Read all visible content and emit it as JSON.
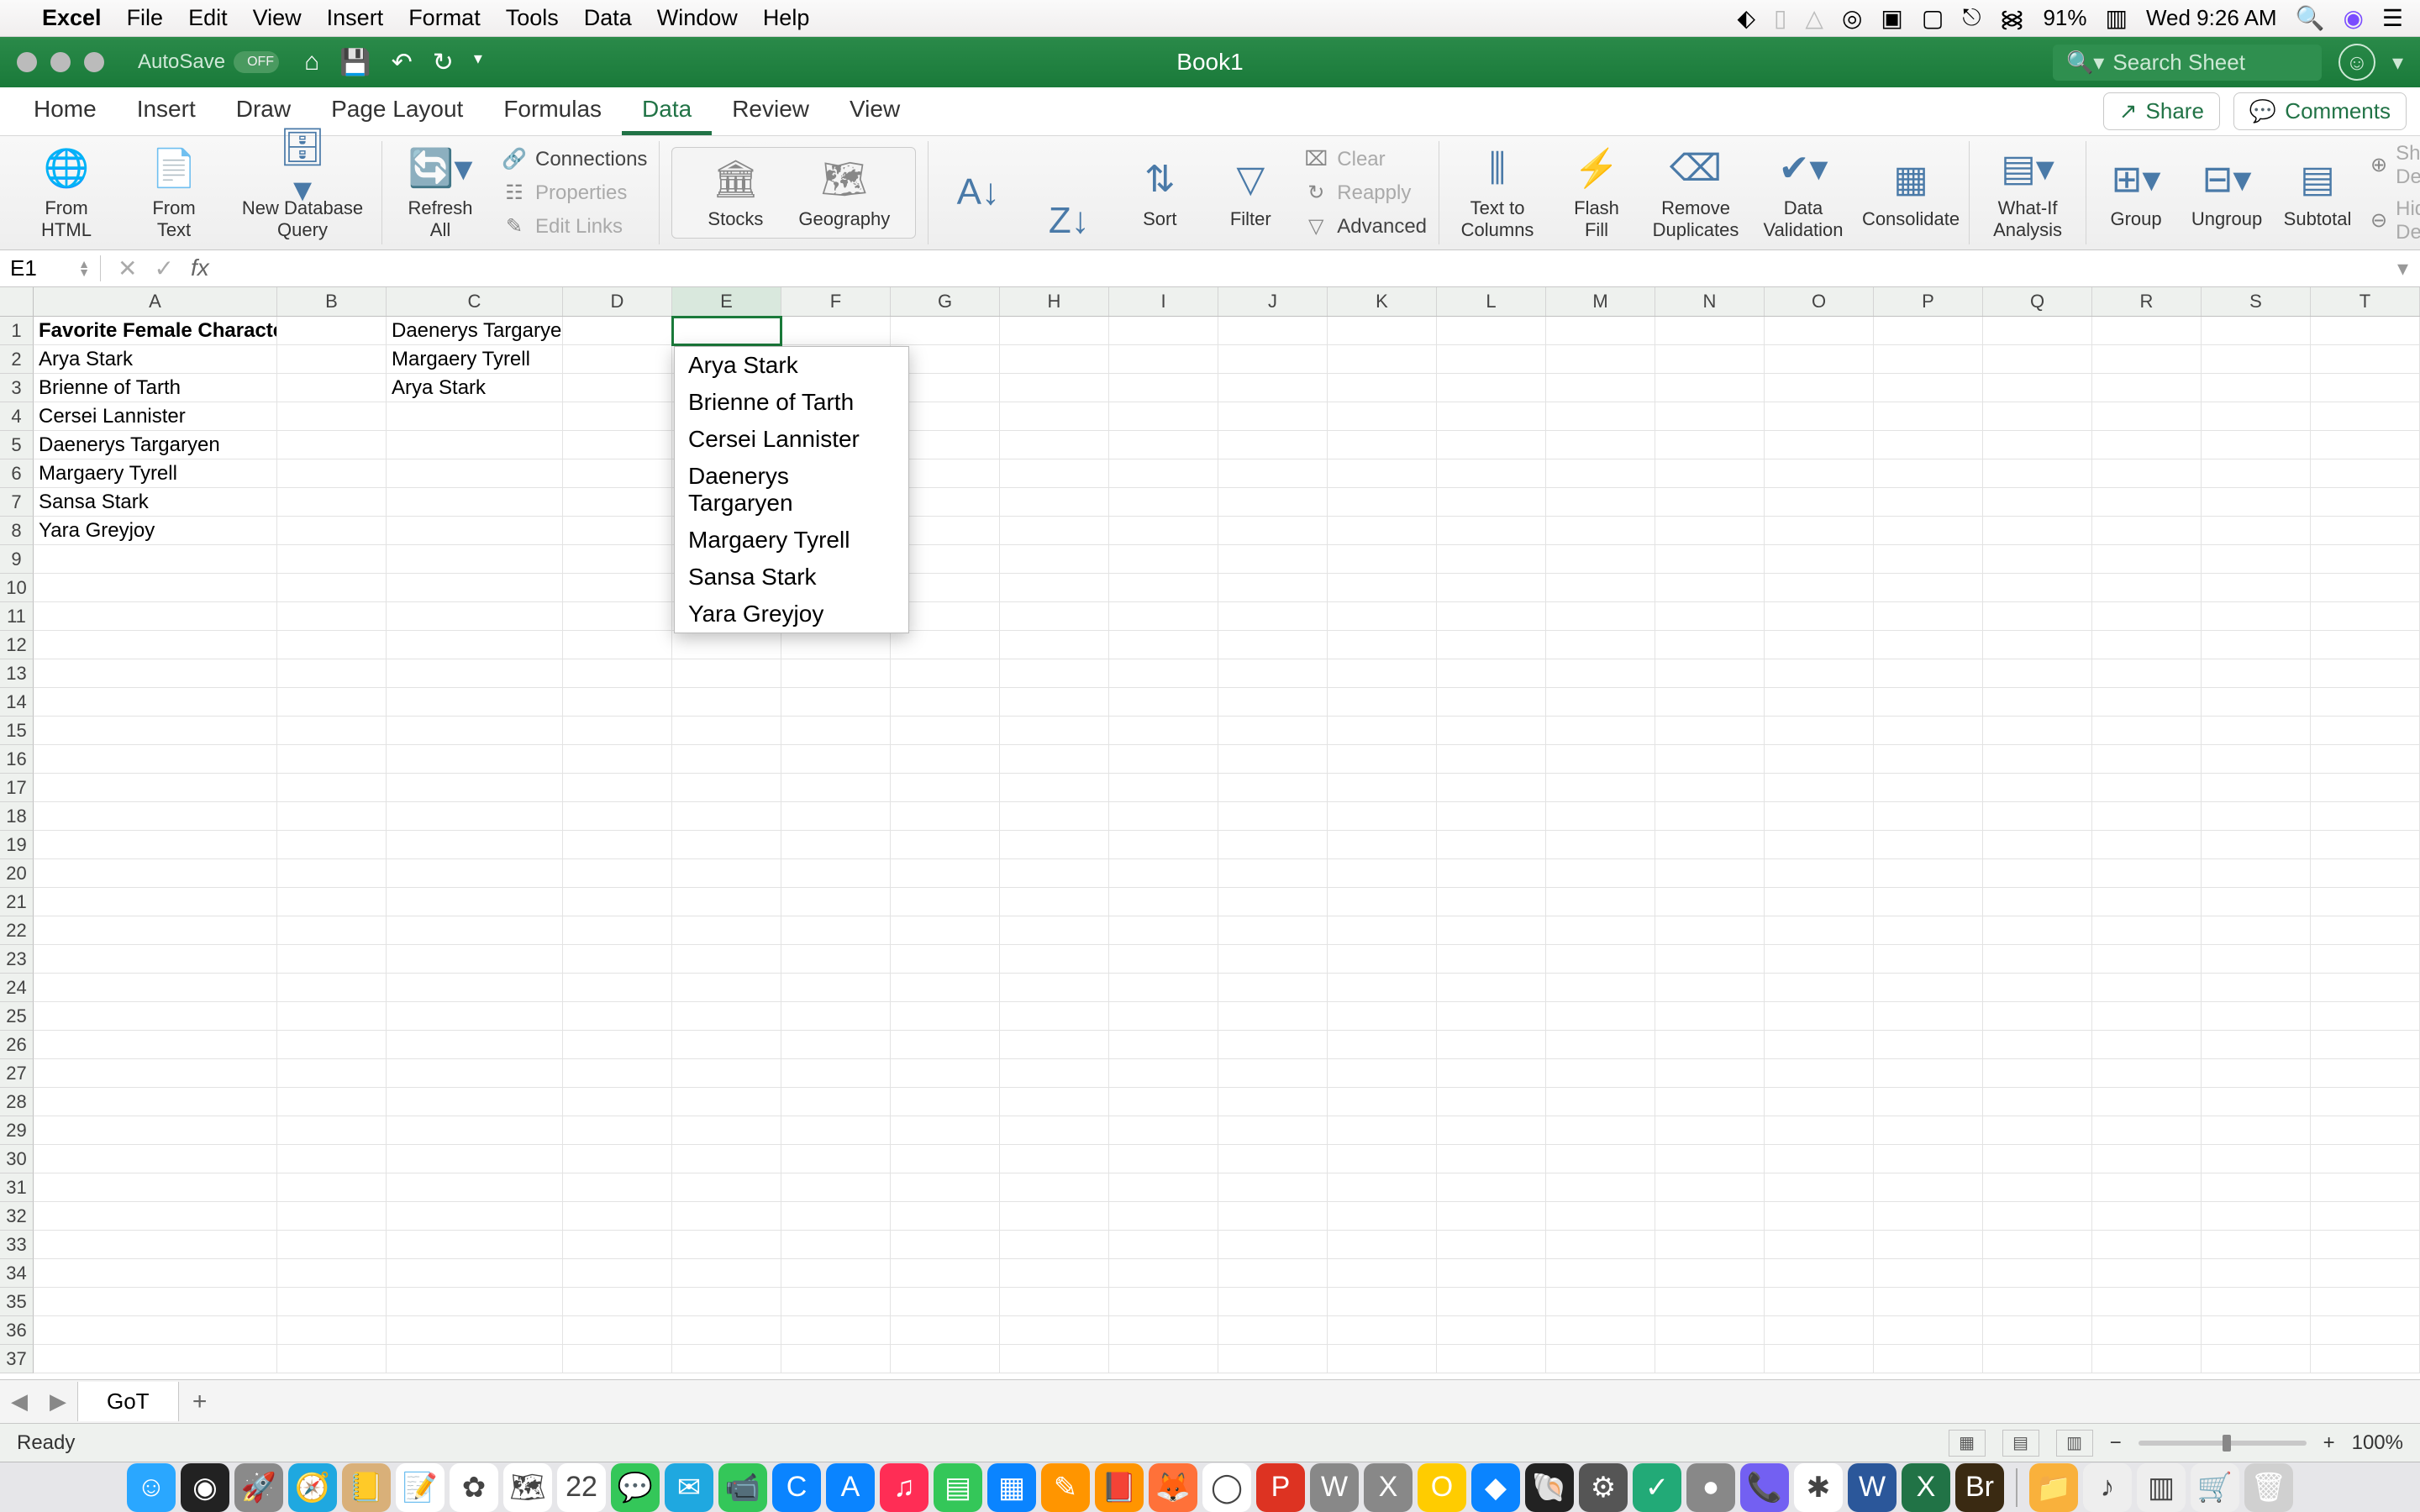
{
  "mac_menu": {
    "app": "Excel",
    "items": [
      "File",
      "Edit",
      "View",
      "Insert",
      "Format",
      "Tools",
      "Data",
      "Window",
      "Help"
    ],
    "battery": "91%",
    "clock": "Wed 9:26 AM"
  },
  "titlebar": {
    "autosave_label": "AutoSave",
    "autosave_state": "OFF",
    "doc_title": "Book1",
    "search_placeholder": "Search Sheet"
  },
  "ribbon_tabs": [
    "Home",
    "Insert",
    "Draw",
    "Page Layout",
    "Formulas",
    "Data",
    "Review",
    "View"
  ],
  "active_tab": "Data",
  "share_label": "Share",
  "comments_label": "Comments",
  "ribbon": {
    "from_html": "From\nHTML",
    "from_text": "From\nText",
    "new_db_query": "New Database\nQuery",
    "refresh_all": "Refresh\nAll",
    "connections": "Connections",
    "properties": "Properties",
    "edit_links": "Edit Links",
    "stocks": "Stocks",
    "geography": "Geography",
    "sort": "Sort",
    "filter": "Filter",
    "clear": "Clear",
    "reapply": "Reapply",
    "advanced": "Advanced",
    "text_to_columns": "Text to\nColumns",
    "flash_fill": "Flash\nFill",
    "remove_duplicates": "Remove\nDuplicates",
    "data_validation": "Data\nValidation",
    "consolidate": "Consolidate",
    "whatif": "What-If\nAnalysis",
    "group": "Group",
    "ungroup": "Ungroup",
    "subtotal": "Subtotal",
    "show_detail": "Show Detail",
    "hide_detail": "Hide Detail"
  },
  "namebox": "E1",
  "columns": [
    "A",
    "B",
    "C",
    "D",
    "E",
    "F",
    "G",
    "H",
    "I",
    "J",
    "K",
    "L",
    "M",
    "N",
    "O",
    "P",
    "Q",
    "R",
    "S",
    "T"
  ],
  "selected_col": "E",
  "row_count": 37,
  "cells": {
    "A1": "Favorite Female Characters",
    "A2": "Arya Stark",
    "A3": "Brienne of Tarth",
    "A4": "Cersei Lannister",
    "A5": "Daenerys Targaryen",
    "A6": "Margaery Tyrell",
    "A7": "Sansa Stark",
    "A8": "Yara Greyjoy",
    "C1": "Daenerys Targaryen",
    "C2": "Margaery Tyrell",
    "C3": "Arya Stark"
  },
  "selected_cell": "E1",
  "dropdown_items": [
    "Arya Stark",
    "Brienne of Tarth",
    "Cersei Lannister",
    "Daenerys Targaryen",
    "Margaery Tyrell",
    "Sansa Stark",
    "Yara Greyjoy"
  ],
  "sheet_tab": "GoT",
  "status": "Ready",
  "zoom": "100%",
  "dock_apps": [
    {
      "n": "finder",
      "c": "#2aa7ff",
      "t": "☺"
    },
    {
      "n": "siri",
      "c": "#222",
      "t": "◉"
    },
    {
      "n": "launchpad",
      "c": "#8a8a8a",
      "t": "🚀"
    },
    {
      "n": "safari",
      "c": "#1fa8e0",
      "t": "🧭"
    },
    {
      "n": "contacts",
      "c": "#d9b079",
      "t": "📒"
    },
    {
      "n": "reminders",
      "c": "#fff",
      "t": "📝"
    },
    {
      "n": "photos",
      "c": "#fff",
      "t": "✿"
    },
    {
      "n": "maps",
      "c": "#fff",
      "t": "🗺"
    },
    {
      "n": "calendar",
      "c": "#fff",
      "t": "22"
    },
    {
      "n": "messages",
      "c": "#34c759",
      "t": "💬"
    },
    {
      "n": "mail",
      "c": "#1fa8e0",
      "t": "✉"
    },
    {
      "n": "facetime",
      "c": "#34c759",
      "t": "📹"
    },
    {
      "n": "app1",
      "c": "#0a84ff",
      "t": "C"
    },
    {
      "n": "appstore",
      "c": "#0a84ff",
      "t": "A"
    },
    {
      "n": "itunes",
      "c": "#ff2d55",
      "t": "♫"
    },
    {
      "n": "numbers",
      "c": "#34c759",
      "t": "▤"
    },
    {
      "n": "keynote",
      "c": "#0a84ff",
      "t": "▦"
    },
    {
      "n": "pages",
      "c": "#ff9500",
      "t": "✎"
    },
    {
      "n": "books",
      "c": "#ff9500",
      "t": "📕"
    },
    {
      "n": "firefox",
      "c": "#ff7139",
      "t": "🦊"
    },
    {
      "n": "chrome",
      "c": "#fff",
      "t": "◯"
    },
    {
      "n": "p",
      "c": "#d32",
      "t": "P"
    },
    {
      "n": "w",
      "c": "#888",
      "t": "W"
    },
    {
      "n": "x",
      "c": "#888",
      "t": "X"
    },
    {
      "n": "o",
      "c": "#ffcc00",
      "t": "O"
    },
    {
      "n": "app2",
      "c": "#0a84ff",
      "t": "◆"
    },
    {
      "n": "app3",
      "c": "#222",
      "t": "🐚"
    },
    {
      "n": "app4",
      "c": "#555",
      "t": "⚙"
    },
    {
      "n": "app5",
      "c": "#2a7",
      "t": "✓"
    },
    {
      "n": "app6",
      "c": "#888",
      "t": "●"
    },
    {
      "n": "viber",
      "c": "#7360f2",
      "t": "📞"
    },
    {
      "n": "slack",
      "c": "#fff",
      "t": "✱"
    },
    {
      "n": "word",
      "c": "#2b579a",
      "t": "W"
    },
    {
      "n": "excel",
      "c": "#217346",
      "t": "X"
    },
    {
      "n": "bridge",
      "c": "#3a2a12",
      "t": "Br"
    },
    {
      "n": "folder",
      "c": "#f9b13c",
      "t": "📁"
    },
    {
      "n": "music",
      "c": "#eee",
      "t": "♪"
    },
    {
      "n": "app7",
      "c": "#eee",
      "t": "▥"
    },
    {
      "n": "app8",
      "c": "#eee",
      "t": "🛒"
    },
    {
      "n": "trash",
      "c": "#d0d0d0",
      "t": "🗑"
    }
  ]
}
